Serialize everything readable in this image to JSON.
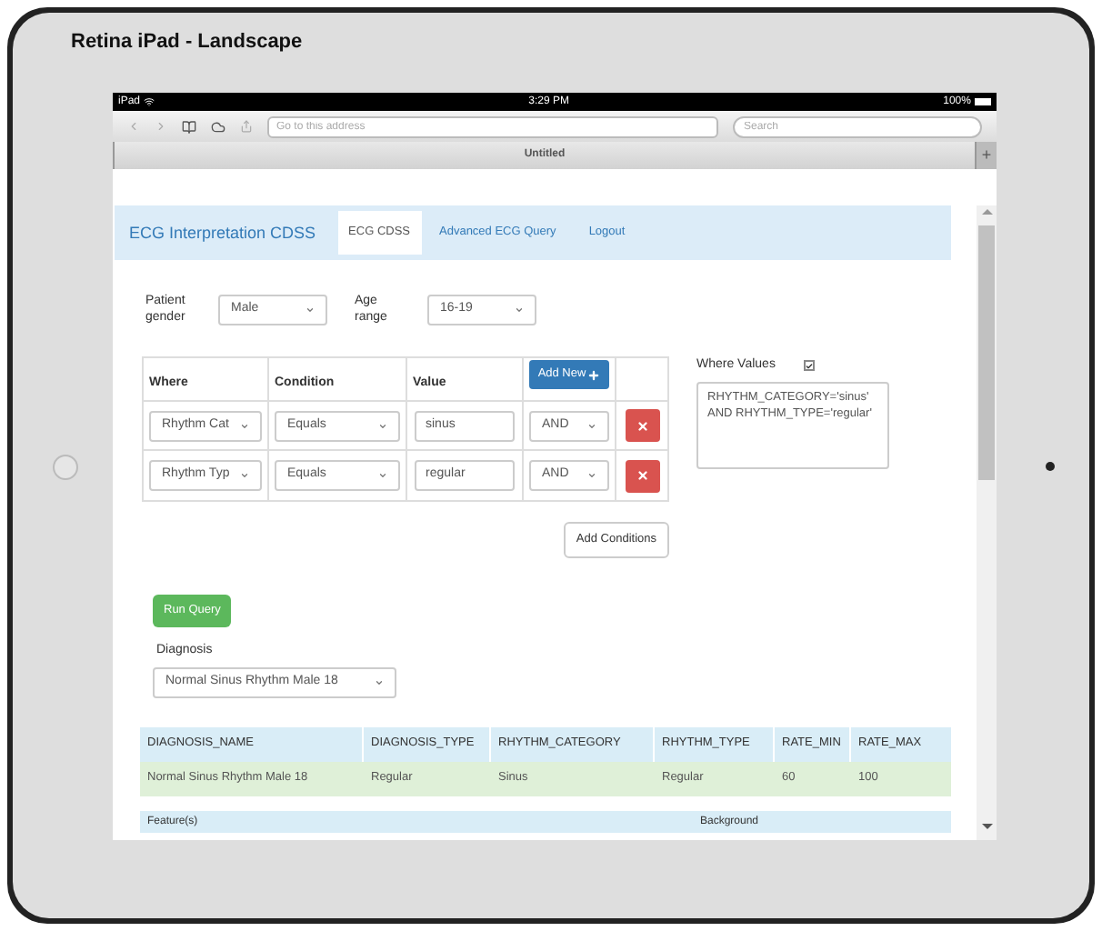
{
  "device": {
    "title": "Retina iPad - Landscape"
  },
  "status_bar": {
    "carrier": "iPad",
    "time": "3:29 PM",
    "battery": "100%"
  },
  "browser": {
    "address_placeholder": "Go to this address",
    "search_placeholder": "Search",
    "tab_title": "Untitled",
    "new_tab": "+"
  },
  "navbar": {
    "brand": "ECG Interpretation CDSS",
    "tabs": [
      {
        "label": "ECG CDSS",
        "selected": true
      },
      {
        "label": "Advanced ECG Query",
        "selected": false
      },
      {
        "label": "Logout",
        "selected": false
      }
    ]
  },
  "filters": [
    {
      "label": "Patient gender",
      "value": "Male"
    },
    {
      "label": "Age range",
      "value": "16-19"
    }
  ],
  "conditions": {
    "columns": [
      "Where",
      "Condition",
      "Value"
    ],
    "add_button": "Add New",
    "rows": [
      {
        "where": "Rhythm Cat",
        "condition": "Equals",
        "value": "sinus",
        "operator": "AND"
      },
      {
        "where": "Rhythm Typ",
        "condition": "Equals",
        "value": "regular",
        "operator": "AND"
      }
    ],
    "add_conditions": "Add Conditions"
  },
  "where_values": {
    "label": "Where Values",
    "checked": true,
    "text": "RHYTHM_CATEGORY='sinus' AND RHYTHM_TYPE='regular'"
  },
  "run_query": "Run Query",
  "diagnosis": {
    "label": "Diagnosis",
    "value": "Normal Sinus Rhythm Male 18"
  },
  "results": {
    "columns": [
      "DIAGNOSIS_NAME",
      "DIAGNOSIS_TYPE",
      "RHYTHM_CATEGORY",
      "RHYTHM_TYPE",
      "RATE_MIN",
      "RATE_MAX"
    ],
    "rows": [
      {
        "cells": [
          "Normal Sinus Rhythm Male 18",
          "Regular",
          "Sinus",
          "Regular",
          "60",
          "100"
        ]
      }
    ]
  },
  "features_table": {
    "columns": [
      "Feature(s)",
      "Background"
    ]
  }
}
